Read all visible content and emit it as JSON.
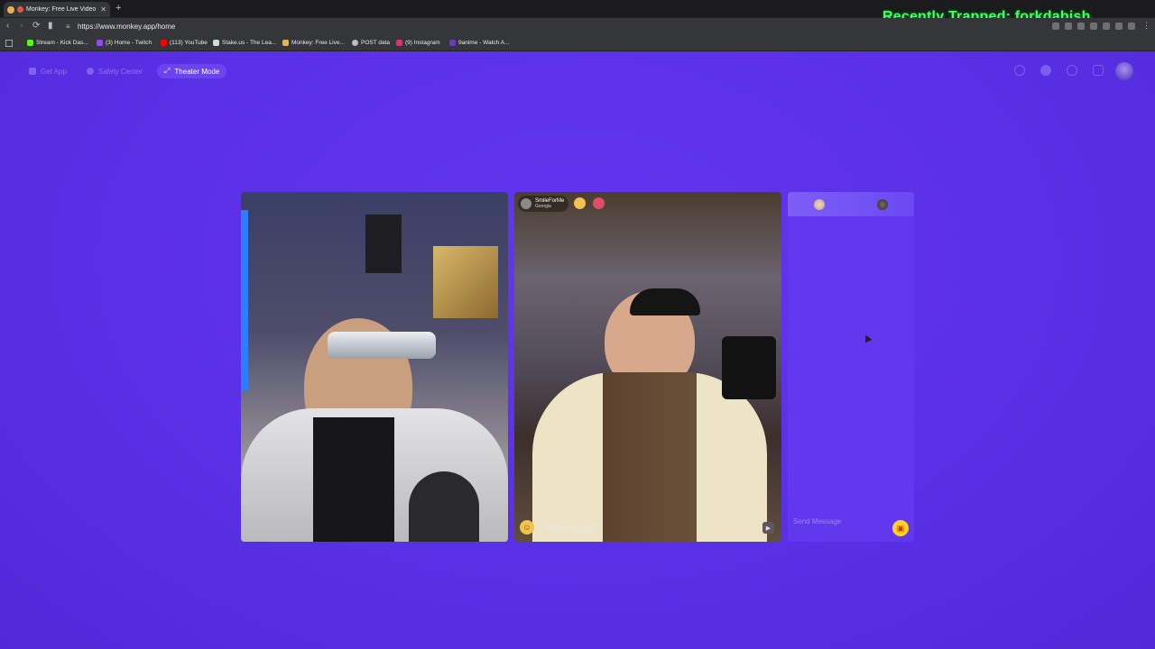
{
  "browser": {
    "tab_title": "Monkey: Free Live Video Ch",
    "url": "https://www.monkey.app/home",
    "overlay_text": "Recently Trapped: forkdabish",
    "bookmarks": [
      {
        "label": "Stream - Kick Das...",
        "color": "#53fc18"
      },
      {
        "label": "(3) Home - Twitch",
        "color": "#9146ff"
      },
      {
        "label": "(113) YouTube",
        "color": "#ff0000"
      },
      {
        "label": "Stake.us - The Lea...",
        "color": "#cfd8dc"
      },
      {
        "label": "Monkey: Free Live...",
        "color": "#e8b24c"
      },
      {
        "label": "POST data",
        "color": "#bdbdbd"
      },
      {
        "label": "(9) Instagram",
        "color": "#e1306c"
      },
      {
        "label": "9anime - Watch A...",
        "color": "#6a3fb5"
      }
    ]
  },
  "topnav": {
    "get_app": "Get App",
    "safety_center": "Safety Center",
    "theater_mode": "Theater Mode"
  },
  "remote_user": {
    "name": "SmileForMe",
    "location": "Georgia"
  },
  "watermark": "monkey.app",
  "chat": {
    "placeholder": "Send Message"
  },
  "colors": {
    "background": "#5a30e6",
    "chat_panel": "#6138ee",
    "gift": "#ffd21f"
  }
}
